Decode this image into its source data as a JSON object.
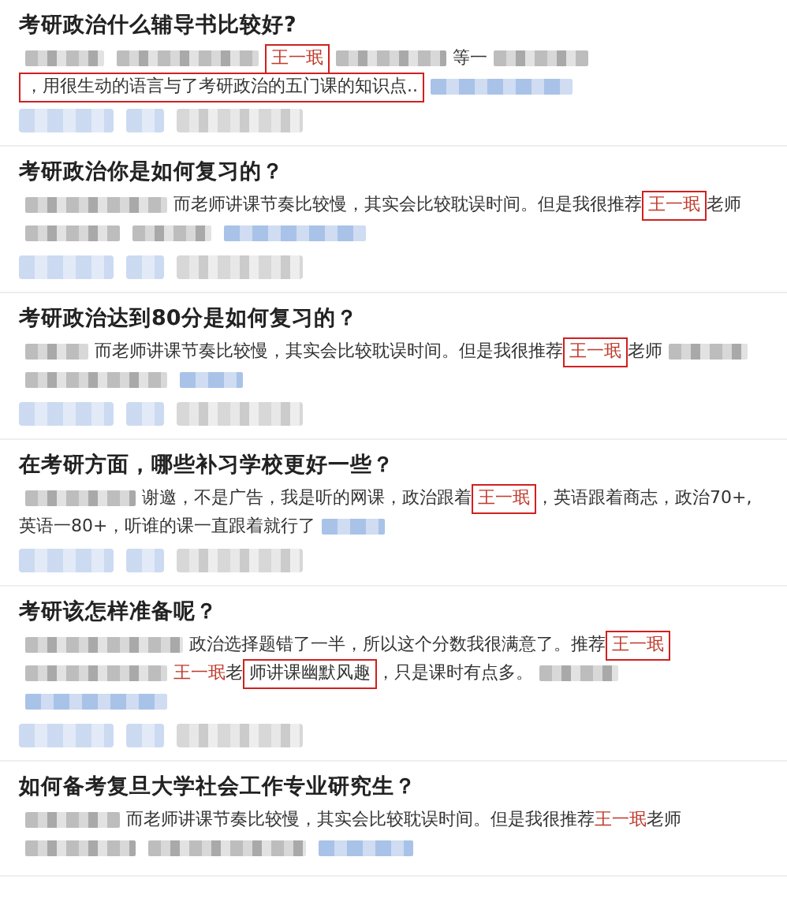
{
  "results": [
    {
      "title": "考研政治什么辅导书比较好?",
      "meta": true,
      "snippet": [
        {
          "kind": "blur"
        },
        {
          "kind": "blur"
        },
        {
          "kind": "name",
          "text": "王一珉",
          "boxed": true
        },
        {
          "kind": "blur"
        },
        {
          "kind": "text",
          "text": "等一"
        },
        {
          "kind": "blur"
        },
        {
          "kind": "text",
          "text": "，用很生动的语言与了考研政治的五门课的知识点..",
          "boxed": true
        },
        {
          "kind": "link-blur"
        }
      ]
    },
    {
      "title": "考研政治你是如何复习的？",
      "meta": true,
      "snippet": [
        {
          "kind": "blur"
        },
        {
          "kind": "text",
          "text": "而老师讲课节奏比较慢，其实会比较耽误时间。但是我很推荐"
        },
        {
          "kind": "name",
          "text": "王一珉",
          "boxed": true
        },
        {
          "kind": "text",
          "text": "老师"
        },
        {
          "kind": "blur"
        },
        {
          "kind": "blur"
        },
        {
          "kind": "link-blur"
        }
      ]
    },
    {
      "title": "考研政治达到80分是如何复习的？",
      "meta": true,
      "snippet": [
        {
          "kind": "blur"
        },
        {
          "kind": "text",
          "text": "而老师讲课节奏比较慢，其实会比较耽误时间。但是我很推荐"
        },
        {
          "kind": "name",
          "text": "王一珉",
          "boxed": true
        },
        {
          "kind": "text",
          "text": "老师"
        },
        {
          "kind": "blur"
        },
        {
          "kind": "blur"
        },
        {
          "kind": "link-blur"
        }
      ]
    },
    {
      "title": "在考研方面，哪些补习学校更好一些？",
      "meta": true,
      "snippet": [
        {
          "kind": "blur"
        },
        {
          "kind": "text",
          "text": "谢邀，不是广告，我是听的网课，政治跟着"
        },
        {
          "kind": "name",
          "text": "王一珉",
          "boxed": true
        },
        {
          "kind": "text",
          "text": "，英语跟着商志，政治70+,"
        },
        {
          "kind": "text",
          "text": "英语一80+，听谁的课一直跟着就行了"
        },
        {
          "kind": "link-blur"
        }
      ]
    },
    {
      "title": "考研该怎样准备呢？",
      "meta": true,
      "snippet": [
        {
          "kind": "blur"
        },
        {
          "kind": "text",
          "text": "政治选择题错了一半，所以这个分数我很满意了。推荐"
        },
        {
          "kind": "name",
          "text": "王一珉",
          "boxed": true
        },
        {
          "kind": "blur"
        },
        {
          "kind": "name",
          "text": "王一珉"
        },
        {
          "kind": "text",
          "text": "老"
        },
        {
          "kind": "text",
          "text": "师讲课幽默风趣",
          "boxed": true
        },
        {
          "kind": "text",
          "text": "，只是课时有点多。"
        },
        {
          "kind": "blur"
        },
        {
          "kind": "link-blur"
        }
      ]
    },
    {
      "title": "如何备考复旦大学社会工作专业研究生？",
      "meta": false,
      "snippet": [
        {
          "kind": "blur"
        },
        {
          "kind": "text",
          "text": "而老师讲课节奏比较慢，其实会比较耽误时间。但是我很推荐"
        },
        {
          "kind": "name",
          "text": "王一珉"
        },
        {
          "kind": "text",
          "text": "老师"
        },
        {
          "kind": "blur"
        },
        {
          "kind": "blur"
        },
        {
          "kind": "link-blur"
        }
      ]
    }
  ]
}
